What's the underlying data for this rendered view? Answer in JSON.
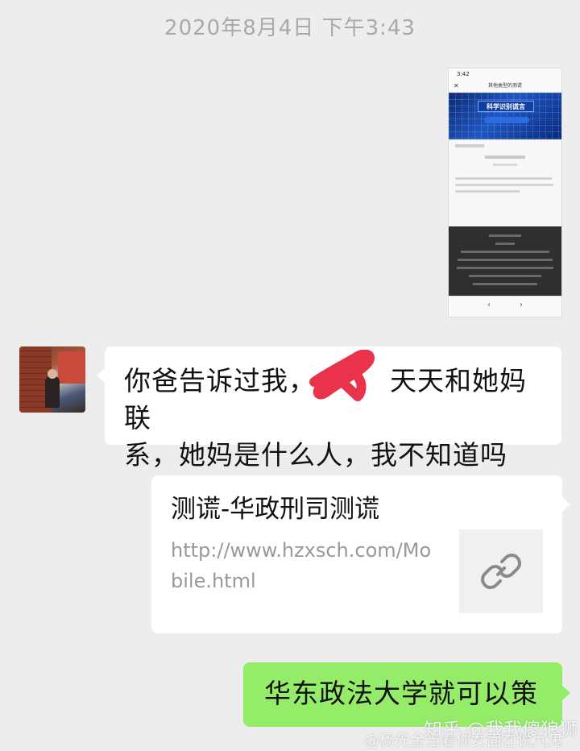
{
  "chat": {
    "timestamp": "2020年8月4日 下午3:43",
    "screenshot_message": {
      "status_time": "3:42",
      "nav_title": "其他类型的测谎",
      "banner_title": "科学识别谎言"
    },
    "incoming_message": {
      "text_line1": "你爸告诉过我，",
      "text_line1_after": "天天和她妈联",
      "text_line2": "系，她妈是什么人，我不知道吗"
    },
    "link_card": {
      "title": "测谎-华政刑司测谎",
      "url": "http://www.hzxsch.com/Mobile.html",
      "icon": "link-icon"
    },
    "outgoing_message": {
      "text": "华东政法大学就可以策"
    }
  },
  "watermark": {
    "line1": "知乎 @我我傻狼狮",
    "line2": "@杨光金当着你女面在说九鬼"
  },
  "colors": {
    "background": "#ededed",
    "incoming_bubble": "#ffffff",
    "outgoing_bubble": "#95ec69",
    "scribble": "#e8334a"
  }
}
